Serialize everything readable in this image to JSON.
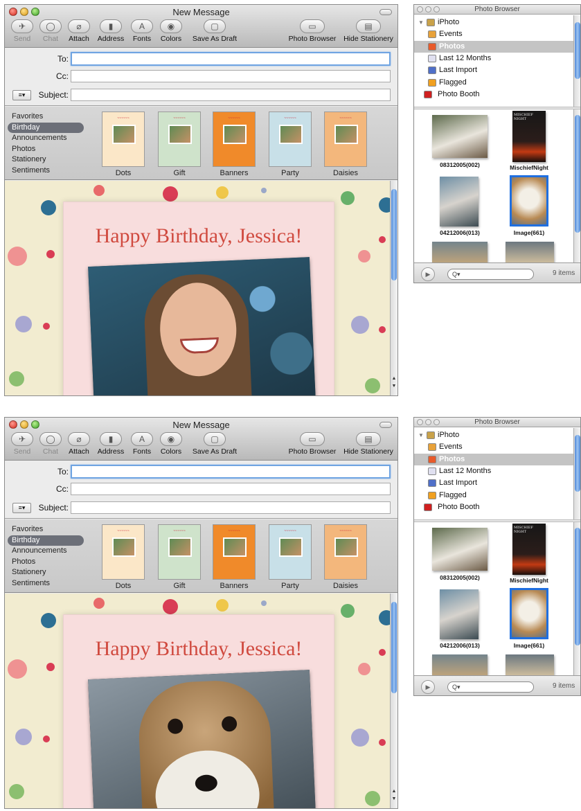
{
  "colors": {
    "accent": "#2f6fd8",
    "greeting": "#d04a3f",
    "selection": "#6c6f78"
  },
  "mail": {
    "title": "New Message",
    "toolbar": [
      {
        "label": "Send",
        "icon": "send-icon",
        "enabled": false
      },
      {
        "label": "Chat",
        "icon": "chat-icon",
        "enabled": false
      },
      {
        "label": "Attach",
        "icon": "paperclip-icon",
        "enabled": true
      },
      {
        "label": "Address",
        "icon": "address-book-icon",
        "enabled": true
      },
      {
        "label": "Fonts",
        "icon": "fonts-icon",
        "enabled": true
      },
      {
        "label": "Colors",
        "icon": "color-wheel-icon",
        "enabled": true
      },
      {
        "label": "Save As Draft",
        "icon": "draft-icon",
        "enabled": true
      },
      {
        "label": "Photo Browser",
        "icon": "photo-browser-icon",
        "enabled": true
      },
      {
        "label": "Hide Stationery",
        "icon": "stationery-icon",
        "enabled": true
      }
    ],
    "fields": {
      "to_label": "To:",
      "to_value": "",
      "cc_label": "Cc:",
      "cc_value": "",
      "subject_label": "Subject:",
      "subject_value": ""
    },
    "stationery": {
      "categories": [
        "Favorites",
        "Birthday",
        "Announcements",
        "Photos",
        "Stationery",
        "Sentiments"
      ],
      "selected_category": "Birthday",
      "templates": [
        "Dots",
        "Gift",
        "Banners",
        "Party",
        "Daisies"
      ]
    },
    "greeting": "Happy Birthday, Jessica!"
  },
  "photo_browser": {
    "title": "Photo Browser",
    "sources": [
      "iPhoto",
      "Events",
      "Photos",
      "Last 12 Months",
      "Last Import",
      "Flagged",
      "Photo Booth"
    ],
    "selected_source": "Photos",
    "photos": [
      {
        "label": "08312005(002)",
        "selected": false
      },
      {
        "label": "MischiefNight",
        "selected": false
      },
      {
        "label": "04212006(013)",
        "selected": false
      },
      {
        "label": "Image(661)",
        "selected": true
      }
    ],
    "poster_text": "MISCHIEF NIGHT",
    "search_placeholder": "Q▾",
    "count": "9 items"
  },
  "panels": [
    {
      "photo_subject": "girl"
    },
    {
      "photo_subject": "dog"
    }
  ]
}
